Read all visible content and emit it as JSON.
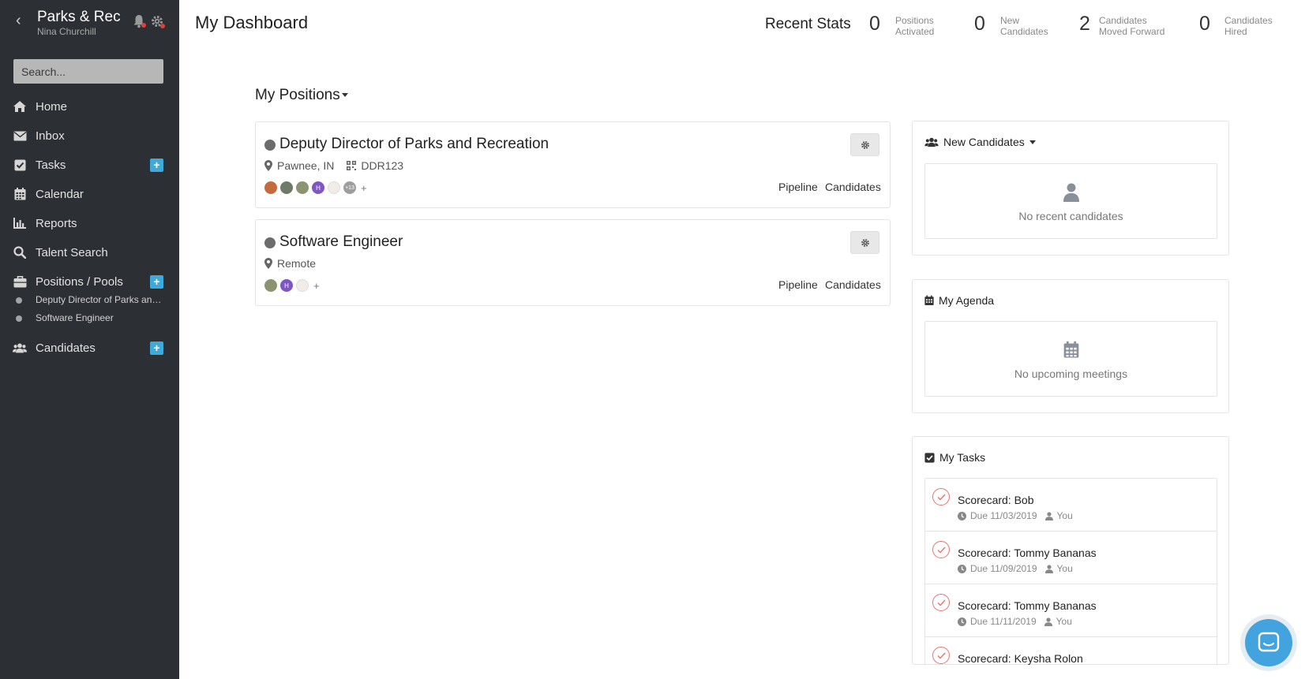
{
  "sidebar": {
    "org_name": "Parks & Rec",
    "user_name": "Nina Churchill",
    "search_placeholder": "Search...",
    "items": [
      {
        "label": "Home",
        "icon": "home-icon"
      },
      {
        "label": "Inbox",
        "icon": "envelope-icon"
      },
      {
        "label": "Tasks",
        "icon": "checkbox-icon",
        "has_add": true
      },
      {
        "label": "Calendar",
        "icon": "calendar-icon"
      },
      {
        "label": "Reports",
        "icon": "bar-chart-icon"
      },
      {
        "label": "Talent Search",
        "icon": "search-icon"
      },
      {
        "label": "Positions / Pools",
        "icon": "briefcase-icon",
        "has_add": true
      },
      {
        "label": "Candidates",
        "icon": "users-icon",
        "has_add": true
      }
    ],
    "sub_items": [
      {
        "label": "Deputy Director of Parks and Recreation"
      },
      {
        "label": "Software Engineer"
      }
    ],
    "add_label": "+"
  },
  "header": {
    "title": "My Dashboard",
    "recent_stats_label": "Recent Stats",
    "stats": [
      {
        "value": "0",
        "line1": "Positions",
        "line2": "Activated"
      },
      {
        "value": "0",
        "line1": "New",
        "line2": "Candidates"
      },
      {
        "value": "2",
        "line1": "Candidates",
        "line2": "Moved Forward"
      },
      {
        "value": "0",
        "line1": "Candidates",
        "line2": "Hired"
      }
    ]
  },
  "positions": {
    "heading": "My Positions",
    "items": [
      {
        "title": "Deputy Director of Parks and Recreation",
        "location": "Pawnee, IN",
        "code": "DDR123",
        "pipeline_label": "Pipeline",
        "candidates_label": "Candidates",
        "avatars": [
          "photo",
          "photo",
          "photo",
          "H",
          "photo",
          "+13"
        ],
        "add_label": "+"
      },
      {
        "title": "Software Engineer",
        "location": "Remote",
        "pipeline_label": "Pipeline",
        "candidates_label": "Candidates",
        "avatars": [
          "photo",
          "H",
          "photo"
        ],
        "add_label": "+"
      }
    ]
  },
  "widgets": {
    "new_candidates": {
      "title": "New Candidates",
      "empty_text": "No recent candidates"
    },
    "agenda": {
      "title": "My Agenda",
      "empty_text": "No upcoming meetings"
    },
    "tasks": {
      "title": "My Tasks",
      "items": [
        {
          "title": "Scorecard: Bob",
          "due": "Due 11/03/2019",
          "assignee": "You"
        },
        {
          "title": "Scorecard: Tommy Bananas",
          "due": "Due 11/09/2019",
          "assignee": "You"
        },
        {
          "title": "Scorecard: Tommy Bananas",
          "due": "Due 11/11/2019",
          "assignee": "You"
        },
        {
          "title": "Scorecard: Keysha Rolon",
          "due": "",
          "assignee": ""
        }
      ]
    }
  },
  "colors": {
    "sidebar_bg": "#2c2f33",
    "accent": "#3fa9d9",
    "chat_button": "#42a3de",
    "task_check": "#e57373"
  }
}
